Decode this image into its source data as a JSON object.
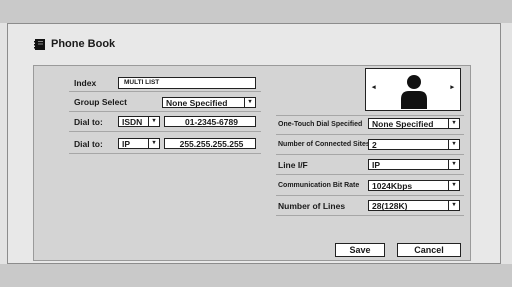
{
  "window": {
    "title": "Phone Book"
  },
  "icons": {
    "title_icon": "book-icon",
    "avatar": "person-silhouette-icon",
    "prev": "triangle-left-icon",
    "next": "triangle-right-icon",
    "dropdown": "triangle-down-icon"
  },
  "left": {
    "index_label": "Index",
    "index_value": "MULTI LIST",
    "group_label": "Group Select",
    "group_value": "None Specified",
    "dial1_label": "Dial to:",
    "dial1_type": "ISDN",
    "dial1_number": "01-2345-6789",
    "dial2_label": "Dial to:",
    "dial2_type": "IP",
    "dial2_number": "255.255.255.255"
  },
  "right": {
    "one_touch_label": "One-Touch Dial Specified",
    "one_touch_value": "None Specified",
    "connected_label": "Number of Connected Sites",
    "connected_value": "2",
    "line_label": "Line I/F",
    "line_value": "IP",
    "rate_label": "Communication Bit Rate",
    "rate_value": "1024Kbps",
    "lines_label": "Number of Lines",
    "lines_value": "28(128K)"
  },
  "buttons": {
    "save": "Save",
    "cancel": "Cancel"
  },
  "arrows": {
    "prev": "◂",
    "next": "▸",
    "down": "▾"
  }
}
